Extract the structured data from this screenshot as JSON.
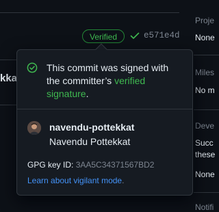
{
  "background": {
    "left_text": "kka"
  },
  "sidebar": {
    "projects_heading": "Proje",
    "projects_value": "None",
    "milestone_heading": "Miles",
    "milestone_value": "No m",
    "development_heading": "Deve",
    "development_text_1": "Succ",
    "development_text_2": "these",
    "development_value": "None",
    "notifications_heading": "Notifi"
  },
  "commit": {
    "badge_label": "Verified",
    "sha": "e571e4d"
  },
  "popover": {
    "message_prefix": "This commit was signed with the committer’s ",
    "message_link": "verified signature",
    "message_suffix": ".",
    "username": "navendu-pottekkat",
    "full_name": "Navendu Pottekkat",
    "gpg_label": "GPG key ID: ",
    "gpg_key_id": "3AA5C34371567BD2",
    "learn_link": "Learn about vigilant mode",
    "learn_suffix": "."
  },
  "colors": {
    "verified_green": "#3fb950",
    "link_blue": "#4493f8",
    "muted": "#7d8590"
  }
}
